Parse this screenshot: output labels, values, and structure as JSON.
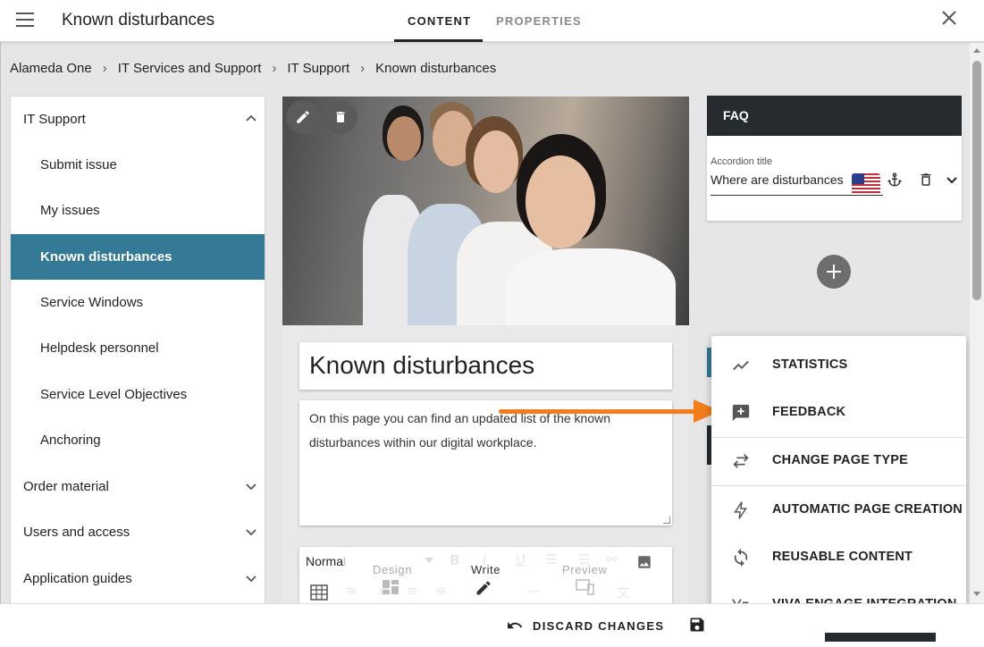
{
  "header": {
    "title": "Known disturbances",
    "tabs": [
      {
        "label": "CONTENT",
        "active": true
      },
      {
        "label": "PROPERTIES",
        "active": false
      }
    ]
  },
  "breadcrumb": [
    "Alameda One",
    "IT Services and Support",
    "IT Support",
    "Known disturbances"
  ],
  "sidebar": {
    "items": [
      {
        "label": "IT Support",
        "level": "top",
        "expanded": true
      },
      {
        "label": "Submit issue",
        "level": "sub"
      },
      {
        "label": "My issues",
        "level": "sub"
      },
      {
        "label": "Known disturbances",
        "level": "sub",
        "active": true
      },
      {
        "label": "Service Windows",
        "level": "sub"
      },
      {
        "label": "Helpdesk personnel",
        "level": "sub"
      },
      {
        "label": "Service Level Objectives",
        "level": "sub"
      },
      {
        "label": "Anchoring",
        "level": "sub"
      },
      {
        "label": "Order material",
        "level": "top"
      },
      {
        "label": "Users and access",
        "level": "top"
      },
      {
        "label": "Application guides",
        "level": "top"
      }
    ]
  },
  "main": {
    "page_title": "Known disturbances",
    "intro_text": "On this page you can find an updated list of the known disturbances within our digital workplace.",
    "editor": {
      "format_value": "Normal",
      "overlay_labels": [
        "Design",
        "Write",
        "Preview"
      ]
    }
  },
  "faq": {
    "title": "FAQ",
    "field_label": "Accordion title",
    "field_value": "Where are disturbances"
  },
  "menu": {
    "items": [
      {
        "label": "STATISTICS",
        "icon": "trending-up-icon"
      },
      {
        "label": "FEEDBACK",
        "icon": "feedback-icon"
      },
      {
        "label": "CHANGE PAGE TYPE",
        "icon": "swap-icon"
      },
      {
        "label": "AUTOMATIC PAGE CREATION",
        "icon": "lightning-icon"
      },
      {
        "label": "REUSABLE CONTENT",
        "icon": "sync-icon"
      },
      {
        "label": "VIVA ENGAGE INTEGRATION",
        "icon": "viva-engage-icon"
      }
    ]
  },
  "footer": {
    "discard_label": "DISCARD CHANGES"
  },
  "colors": {
    "accent": "#347a97",
    "dark": "#262b30",
    "arrow": "#f37d1b"
  }
}
